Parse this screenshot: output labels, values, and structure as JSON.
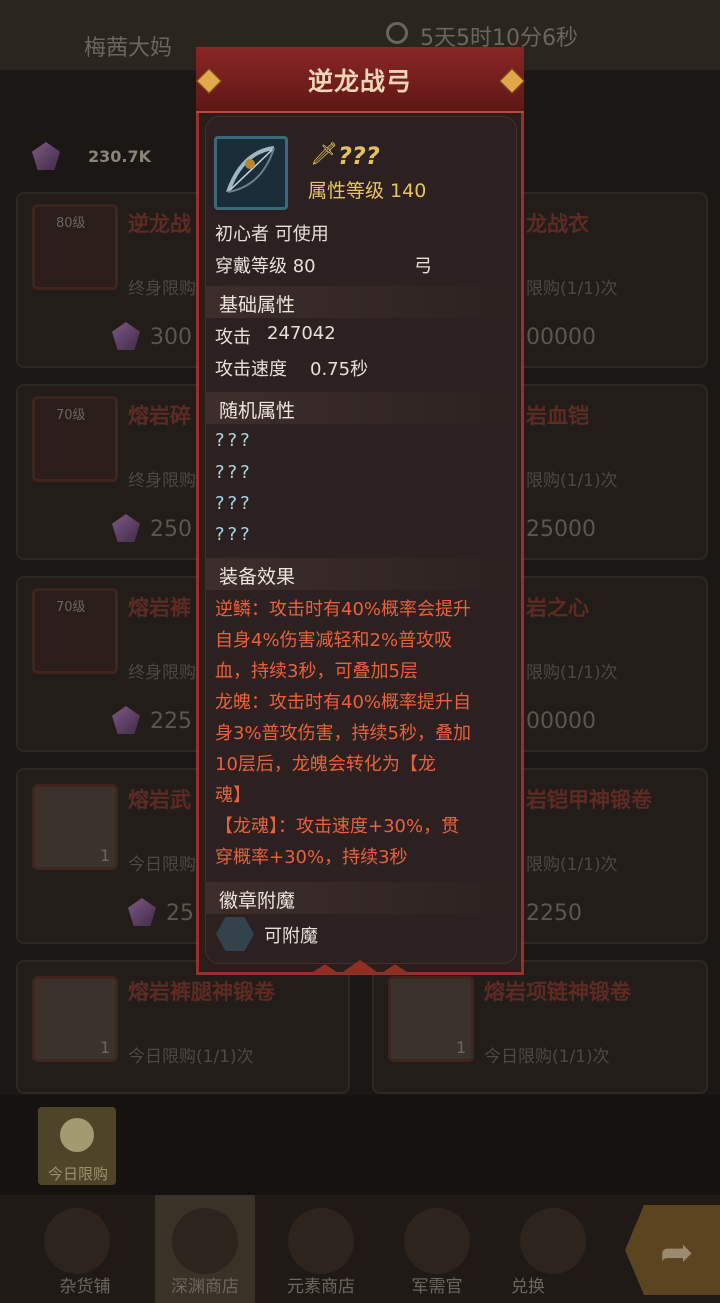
{
  "background": {
    "npc_name": "梅茜大妈",
    "timer": "5天5时10分6秒",
    "currency": "230.7K",
    "cards": [
      {
        "title": "逆龙战",
        "level": "80级",
        "sub": "终身限购",
        "price": "300"
      },
      {
        "title": "龙战衣",
        "sub": "限购(1/1)次",
        "price": "00000"
      },
      {
        "title": "熔岩碎",
        "level": "70级",
        "sub": "终身限购",
        "price": "250"
      },
      {
        "title": "岩血铠",
        "sub": "限购(1/1)次",
        "price": "25000"
      },
      {
        "title": "熔岩裤",
        "level": "70级",
        "sub": "终身限购",
        "price": "225"
      },
      {
        "title": "岩之心",
        "sub": "限购(1/1)次",
        "price": "00000"
      },
      {
        "title": "熔岩武",
        "qty": "1",
        "sub": "今日限购",
        "price": "25"
      },
      {
        "title": "岩铠甲神锻卷",
        "sub": "限购(1/1)次",
        "price": "2250"
      },
      {
        "title": "熔岩裤腿神锻卷",
        "qty": "1",
        "sub": "今日限购(1/1)次"
      },
      {
        "title": "熔岩项链神锻卷",
        "qty": "1",
        "sub": "今日限购(1/1)次"
      }
    ],
    "today_limit_label": "今日限购",
    "nav": [
      {
        "label": "杂货铺",
        "icon": "coins-icon"
      },
      {
        "label": "深渊商店",
        "icon": "ruins-icon"
      },
      {
        "label": "元素商店",
        "icon": "star-icon"
      },
      {
        "label": "军需官",
        "icon": "helmet-icon"
      },
      {
        "label": "兑换",
        "icon": "exchange-icon"
      }
    ]
  },
  "modal": {
    "title": "逆龙战弓",
    "name_hidden": "???",
    "attr_level": "属性等级 140",
    "class_req": "初心者 可使用",
    "wear_level": "穿戴等级 80",
    "weapon_type": "弓",
    "base_section": "基础属性",
    "attack_label": "攻击",
    "attack_value": "247042",
    "speed_label": "攻击速度",
    "speed_value": "0.75秒",
    "random_section": "随机属性",
    "random_lines": [
      "???",
      "???",
      "???",
      "???"
    ],
    "effect_section": "装备效果",
    "effect_lines": [
      "逆鳞：攻击时有40%概率会提升",
      "自身4%伤害减轻和2%普攻吸",
      "血，持续3秒，可叠加5层",
      "龙魄：攻击时有40%概率提升自",
      "身3%普攻伤害，持续5秒，叠加",
      "10层后，龙魄会转化为【龙",
      "魂】",
      "【龙魂】：攻击速度+30%，贯",
      "穿概率+30%，持续3秒"
    ],
    "badge_section": "徽章附魔",
    "badge_text": "可附魔"
  }
}
